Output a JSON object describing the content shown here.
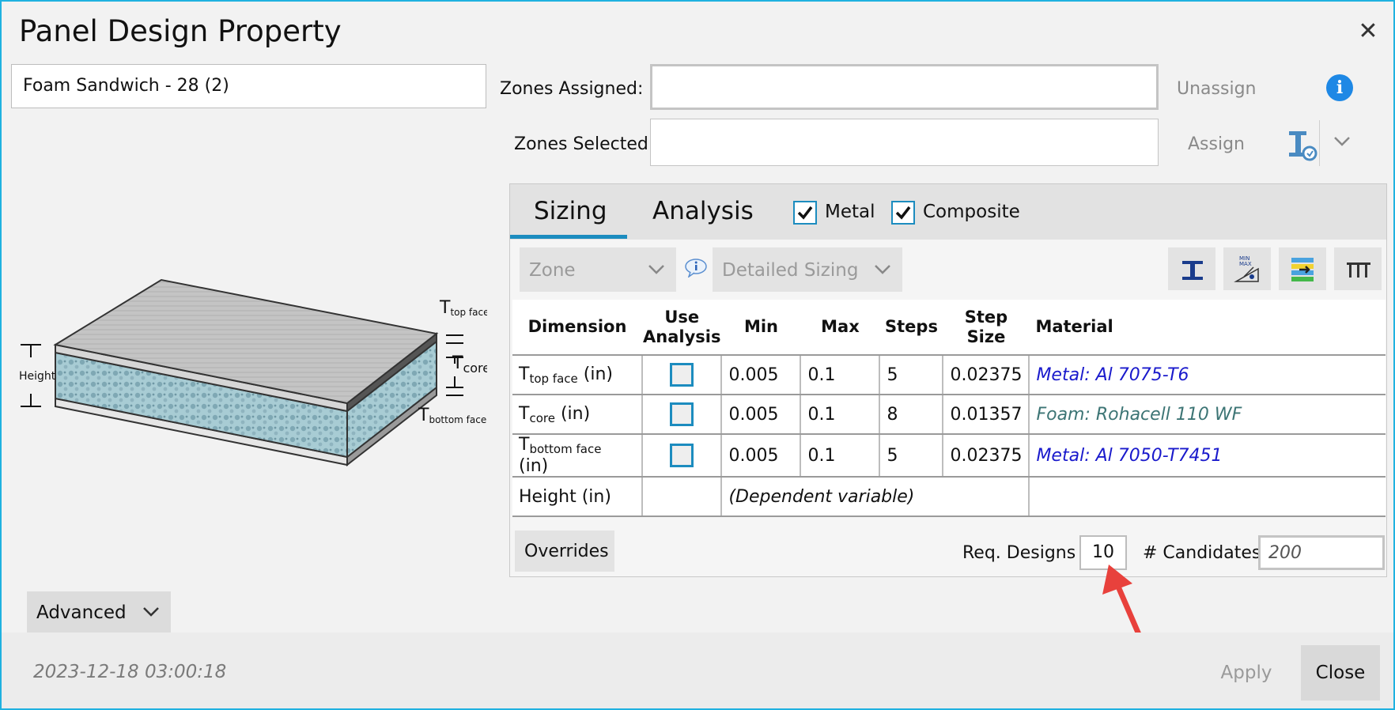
{
  "window": {
    "title": "Panel Design Property",
    "close_glyph": "✕"
  },
  "property_name": "Foam Sandwich - 28 (2)",
  "diagram": {
    "labels": {
      "height": "Height",
      "top_T": "T",
      "top_sub": "top face",
      "core_T": "T",
      "core_sub": "core",
      "bottom_T": "T",
      "bottom_sub": "bottom face"
    },
    "colors": {
      "face": "#b9b9b9",
      "core": "#a8ccd4",
      "dots": "#7fa8b4"
    }
  },
  "zones": {
    "assigned_label": "Zones Assigned:",
    "selected_label": "Zones Selected:",
    "assigned_value": "",
    "selected_value": "",
    "unassign_label": "Unassign",
    "assign_label": "Assign",
    "info_glyph": "i",
    "icons": {
      "info": "info-icon",
      "assign_tool": "assign-tool-icon",
      "dropdown": "chevron-down-icon"
    }
  },
  "tabs": [
    {
      "label": "Sizing",
      "active": true
    },
    {
      "label": "Analysis",
      "active": false
    }
  ],
  "filters": [
    {
      "label": "Metal",
      "checked": true
    },
    {
      "label": "Composite",
      "checked": true
    }
  ],
  "toolbar": {
    "zone_dropdown": "Zone",
    "sizing_dropdown": "Detailed Sizing",
    "icons": [
      "i-beam-icon",
      "min-max-icon",
      "layers-icon",
      "columns-icon"
    ]
  },
  "table": {
    "headers": {
      "dimension": "Dimension",
      "use_analysis_1": "Use",
      "use_analysis_2": "Analysis",
      "min": "Min",
      "max": "Max",
      "steps": "Steps",
      "step_size_1": "Step",
      "step_size_2": "Size",
      "material": "Material"
    },
    "rows": [
      {
        "t": "T",
        "sub": "top face",
        "unit": "(in)",
        "use_analysis": false,
        "min": "0.005",
        "max": "0.1",
        "steps": "5",
        "step_size": "0.02375",
        "material": "Metal: Al 7075-T6",
        "material_kind": "metal"
      },
      {
        "t": "T",
        "sub": "core",
        "unit": "(in)",
        "use_analysis": false,
        "min": "0.005",
        "max": "0.1",
        "steps": "8",
        "step_size": "0.01357",
        "material": "Foam: Rohacell 110 WF",
        "material_kind": "foam"
      },
      {
        "t": "T",
        "sub": "bottom face",
        "unit": "(in)",
        "use_analysis": false,
        "min": "0.005",
        "max": "0.1",
        "steps": "5",
        "step_size": "0.02375",
        "material": "Metal: Al 7050-T7451",
        "material_kind": "metal"
      }
    ],
    "height_row": {
      "label": "Height (in)",
      "note": "(Dependent variable)"
    }
  },
  "bottom": {
    "overrides_label": "Overrides",
    "req_designs_label": "Req. Designs",
    "req_designs_value": "10",
    "candidates_label": "# Candidates",
    "candidates_value": "200"
  },
  "advanced_label": "Advanced",
  "footer": {
    "timestamp": "2023-12-18 03:00:18",
    "apply_label": "Apply",
    "close_label": "Close"
  },
  "colors": {
    "accent": "#1c8cbf",
    "border": "#1fb1e0",
    "metal_link": "#1a1acc",
    "foam_link": "#3d7575",
    "arrow": "#e8413c"
  }
}
